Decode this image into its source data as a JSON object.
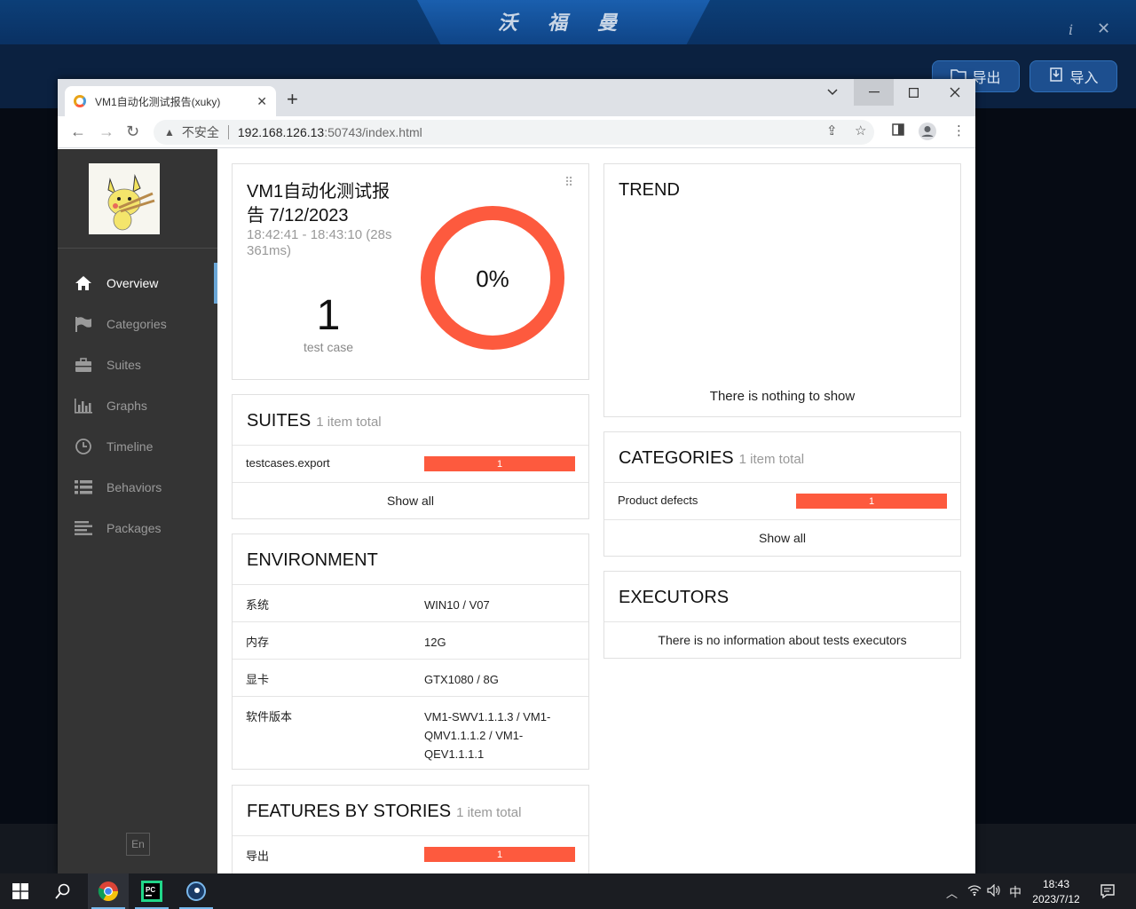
{
  "background_app": {
    "title": "沃 福 曼",
    "info_icon": "i",
    "close_icon": "✕",
    "export_label": "导出",
    "import_label": "导入"
  },
  "browser": {
    "tab_title": "VM1自动化测试报告(xuky)",
    "tab_close": "✕",
    "new_tab": "+",
    "address": {
      "insecure_label": "不安全",
      "host": "192.168.126.13",
      "path": ":50743/index.html"
    }
  },
  "sidebar": {
    "items": [
      {
        "label": "Overview",
        "icon": "home-icon",
        "active": true
      },
      {
        "label": "Categories",
        "icon": "flag-icon",
        "active": false
      },
      {
        "label": "Suites",
        "icon": "briefcase-icon",
        "active": false
      },
      {
        "label": "Graphs",
        "icon": "bar-chart-icon",
        "active": false
      },
      {
        "label": "Timeline",
        "icon": "clock-icon",
        "active": false
      },
      {
        "label": "Behaviors",
        "icon": "list-icon",
        "active": false
      },
      {
        "label": "Packages",
        "icon": "align-left-icon",
        "active": false
      }
    ],
    "language": "En"
  },
  "summary": {
    "title_line1": "VM1自动化测试报",
    "title_line2": "告 7/12/2023",
    "time_line1": "18:42:41 - 18:43:10 (28s",
    "time_line2": "361ms)",
    "test_count": "1",
    "test_count_label": "test case",
    "pass_rate": "0%",
    "pass_rate_value": 0,
    "ring_color": "#fd5a3e"
  },
  "suites": {
    "title": "SUITES",
    "subtitle": "1 item total",
    "rows": [
      {
        "name": "testcases.export",
        "count": "1"
      }
    ],
    "show_all": "Show all"
  },
  "environment": {
    "title": "ENVIRONMENT",
    "rows": [
      {
        "key": "系统",
        "value": "WIN10 / V07"
      },
      {
        "key": "内存",
        "value": "12G"
      },
      {
        "key": "显卡",
        "value": "GTX1080 / 8G"
      },
      {
        "key": "软件版本",
        "value": "VM1-SWV1.1.1.3 / VM1-QMV1.1.1.2 / VM1-QEV1.1.1.1"
      }
    ]
  },
  "features": {
    "title": "FEATURES BY STORIES",
    "subtitle": "1 item total",
    "rows": [
      {
        "name": "导出",
        "count": "1"
      }
    ]
  },
  "trend": {
    "title": "TREND",
    "empty": "There is nothing to show"
  },
  "categories": {
    "title": "CATEGORIES",
    "subtitle": "1 item total",
    "rows": [
      {
        "name": "Product defects",
        "count": "1"
      }
    ],
    "show_all": "Show all"
  },
  "executors": {
    "title": "EXECUTORS",
    "empty": "There is no information about tests executors"
  },
  "taskbar": {
    "ime": "中",
    "time": "18:43",
    "date": "2023/7/12"
  }
}
